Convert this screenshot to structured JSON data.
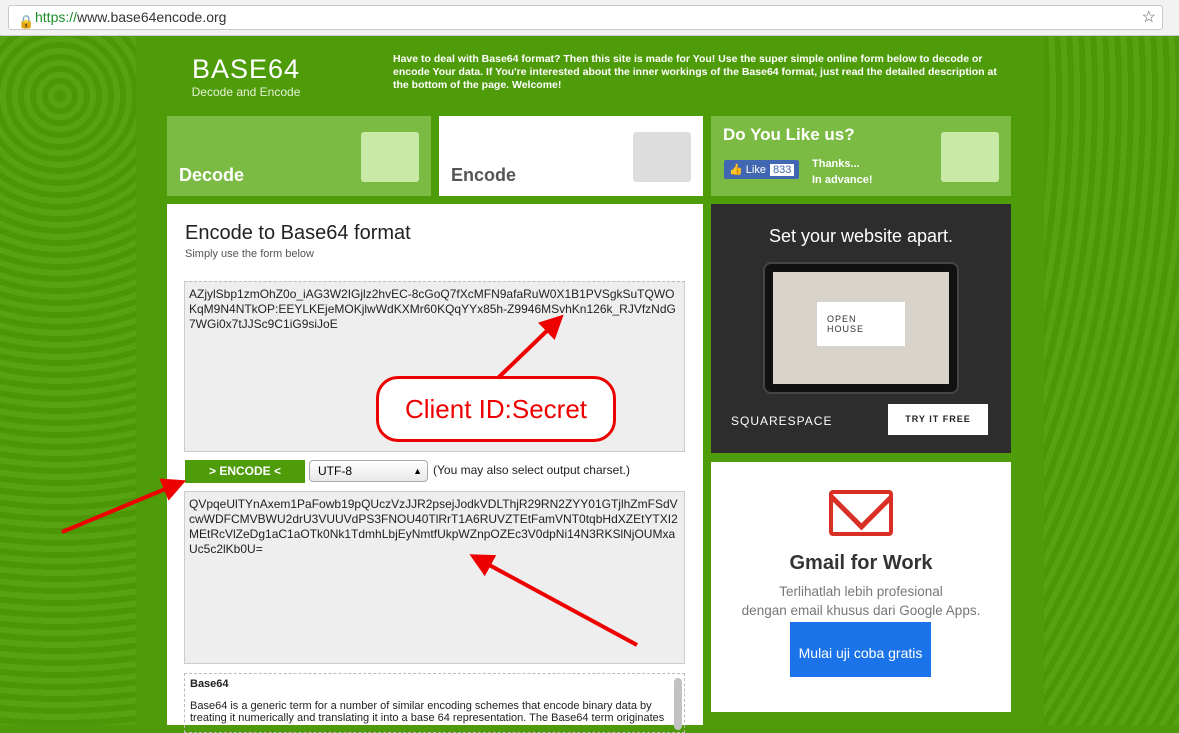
{
  "browser": {
    "url_scheme": "https://",
    "url_host": "www.base64encode.org"
  },
  "logo": {
    "title": "BASE64",
    "subtitle": "Decode and Encode"
  },
  "intro": "Have to deal with Base64 format? Then this site is made for You! Use the super simple online form below to decode or encode Your data. If You're interested about the inner workings of the Base64 format, just read the detailed description at the bottom of the page. Welcome!",
  "tiles": {
    "decode": "Decode",
    "encode": "Encode",
    "like_title": "Do You Like us?",
    "like_button": "Like",
    "like_count": "833",
    "thanks1": "Thanks...",
    "thanks2": "In advance!"
  },
  "form": {
    "title": "Encode to Base64 format",
    "subtitle": "Simply use the form below",
    "input": "AZjylSbp1zmOhZ0o_iAG3W2IGjlz2hvEC-8cGoQ7fXcMFN9afaRuW0X1B1PVSgkSuTQWOKqM9N4NTkOP:EEYLKEjeMOKjlwWdKXMr60KQqYYx85h-Z9946MSvhKn126k_RJVfzNdG7WGi0x7tJJSc9C1iG9siJoE",
    "encode_button": "> ENCODE <",
    "charset": "UTF-8",
    "charset_hint": "(You may also select output charset.)",
    "output": "QVpqeUlTYnAxem1PaFowb19pQUczVzJJR2psejJodkVDLThjR29RN2ZYY01GTjlhZmFSdVcwWDFCMVBWU2drU3VUUVdPS3FNOU40TlRrT1A6RUVZTEtFamVNT0tqbHdXZEtYTXI2MEtRcVlZeDg1aC1aOTk0Nk1TdmhLbjEyNmtfUkpWZnpOZEc3V0dpNi14N3RKSlNjOUMxaUc5c2lKb0U=",
    "desc_title": "Base64",
    "desc_text": "Base64 is a generic term for a number of similar encoding schemes that encode binary data by treating it numerically and translating it into a base 64 representation. The Base64 term originates"
  },
  "annotation": "Client ID:Secret",
  "ad1": {
    "headline": "Set your website apart.",
    "screen_text": "OPEN HOUSE",
    "brand": "SQUARESPACE",
    "cta": "TRY IT FREE"
  },
  "ad2": {
    "title": "Gmail for Work",
    "line1": "Terlihatlah lebih profesional",
    "line2": "dengan email khusus dari Google Apps.",
    "cta": "Mulai uji coba gratis"
  }
}
